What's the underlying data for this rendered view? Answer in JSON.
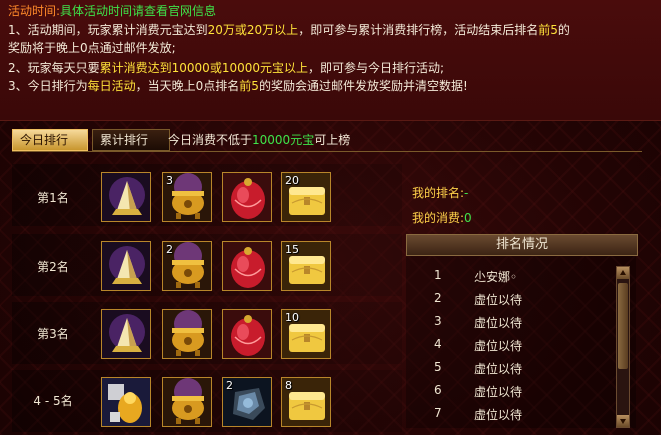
{
  "info": {
    "title_label": "活动时间:",
    "title_value": "具体活动时间请查看官网信息",
    "line1_a": "1、活动期间，玩家累计消费元宝达到",
    "line1_b": "20万或20万以上",
    "line1_c": "，即可参与累计消费排行榜，活动结束后排名",
    "line1_d": "前5",
    "line1_e": "的",
    "line2": "奖励将于晚上0点通过邮件发放;",
    "line3_a": "2、玩家每天只要",
    "line3_b": "累计消费达到10000或10000元宝以上",
    "line3_c": "，即可参与今日排行活动;",
    "line4_a": "3、今日排行为",
    "line4_b": "每日活动",
    "line4_c": "，当天晚上0点排名",
    "line4_d": "前5",
    "line4_e": "的奖励会通过邮件发放奖励并清空数据!"
  },
  "tabs": {
    "today": "今日排行",
    "total": "累计排行",
    "note_a": "今日消费不低于",
    "note_b": "10000元宝",
    "note_c": "可上榜"
  },
  "rewards": [
    {
      "rank": "第1名",
      "items": [
        {
          "icon": "crystal-gift-icon",
          "count": ""
        },
        {
          "icon": "golden-cauldron-icon",
          "count": "3"
        },
        {
          "icon": "red-gem-icon",
          "count": ""
        },
        {
          "icon": "gold-chest-icon",
          "count": "20"
        }
      ]
    },
    {
      "rank": "第2名",
      "items": [
        {
          "icon": "crystal-gift-icon",
          "count": ""
        },
        {
          "icon": "golden-cauldron-icon",
          "count": "2"
        },
        {
          "icon": "red-gem-icon",
          "count": ""
        },
        {
          "icon": "gold-chest-icon",
          "count": "15"
        }
      ]
    },
    {
      "rank": "第3名",
      "items": [
        {
          "icon": "crystal-gift-icon",
          "count": ""
        },
        {
          "icon": "golden-cauldron-icon",
          "count": ""
        },
        {
          "icon": "red-gem-icon",
          "count": ""
        },
        {
          "icon": "gold-chest-icon",
          "count": "10"
        }
      ]
    },
    {
      "rank": "4 - 5名",
      "items": [
        {
          "icon": "gold-idol-icon",
          "count": ""
        },
        {
          "icon": "golden-cauldron-icon",
          "count": ""
        },
        {
          "icon": "dark-stone-icon",
          "count": "2"
        },
        {
          "icon": "gold-chest-icon",
          "count": "8"
        }
      ]
    }
  ],
  "side": {
    "my_rank_label": "我的排名:",
    "my_rank_value": "-",
    "my_spend_label": "我的消费:",
    "my_spend_value": "0",
    "ranking_header": "排名情况"
  },
  "ranking": [
    {
      "no": "1",
      "name": "尐安娜◦"
    },
    {
      "no": "2",
      "name": "虚位以待"
    },
    {
      "no": "3",
      "name": "虚位以待"
    },
    {
      "no": "4",
      "name": "虚位以待"
    },
    {
      "no": "5",
      "name": "虚位以待"
    },
    {
      "no": "6",
      "name": "虚位以待"
    },
    {
      "no": "7",
      "name": "虚位以待"
    }
  ],
  "colors": {
    "accent_green": "#3fe44a",
    "accent_yellow": "#ffe23a",
    "accent_orange": "#ff8a2a"
  }
}
